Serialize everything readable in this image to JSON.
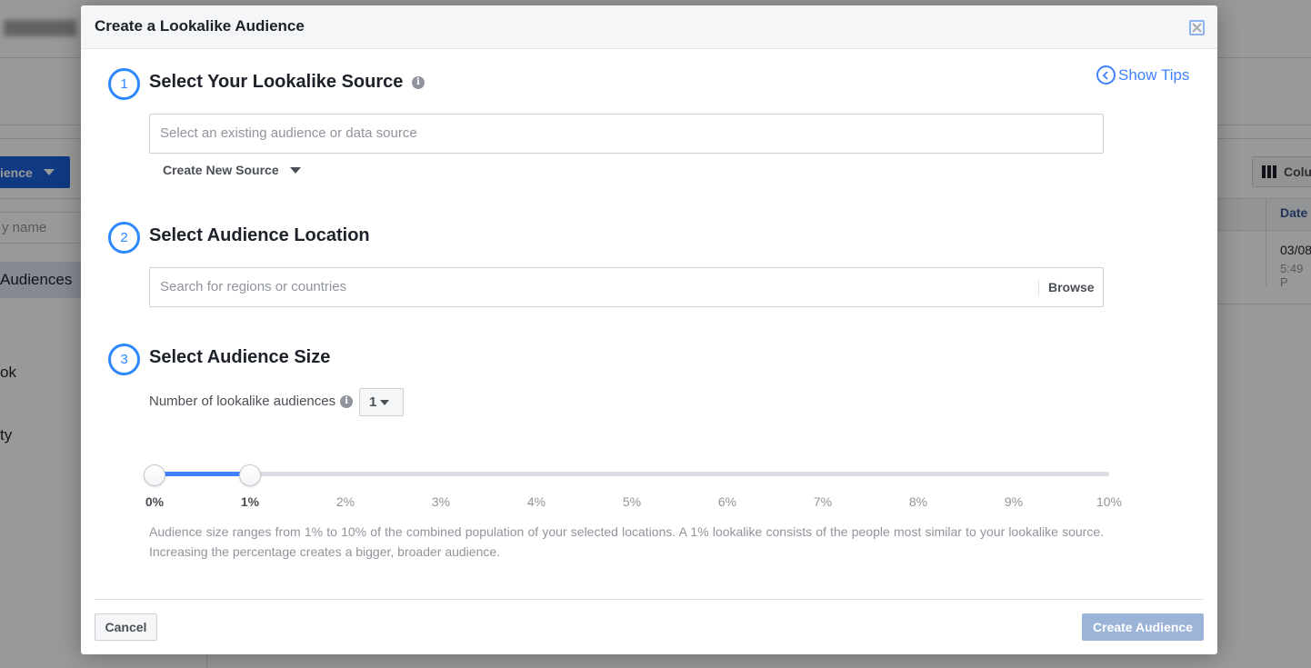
{
  "background": {
    "create_button_label": "ience",
    "search_placeholder": "y name",
    "sidebar_items": [
      {
        "label": "Audiences",
        "active": true
      },
      {
        "label": "ok"
      },
      {
        "label": "ty"
      }
    ],
    "columns_button_label": "Colu",
    "table_header_date": "Date",
    "row_date": "03/08",
    "row_time": "5:49 P"
  },
  "modal": {
    "title": "Create a Lookalike Audience",
    "show_tips_label": "Show Tips",
    "steps": [
      {
        "number": "1",
        "title": "Select Your Lookalike Source"
      },
      {
        "number": "2",
        "title": "Select Audience Location"
      },
      {
        "number": "3",
        "title": "Select Audience Size"
      }
    ],
    "source_input": {
      "placeholder": "Select an existing audience or data source",
      "value": ""
    },
    "create_new_source_label": "Create New Source",
    "location_input": {
      "placeholder": "Search for regions or countries",
      "value": ""
    },
    "browse_label": "Browse",
    "num_audiences_label": "Number of lookalike audiences",
    "num_audiences_value": "1",
    "slider": {
      "min_percent": 0,
      "max_percent": 10,
      "range_start_percent": 0,
      "range_end_percent": 1,
      "ticks": [
        "0%",
        "1%",
        "2%",
        "3%",
        "4%",
        "5%",
        "6%",
        "7%",
        "8%",
        "9%",
        "10%"
      ]
    },
    "description": "Audience size ranges from 1% to 10% of the combined population of your selected locations. A 1% lookalike consists of the people most similar to your lookalike source. Increasing the percentage creates a bigger, broader audience.",
    "cancel_label": "Cancel",
    "create_label": "Create Audience"
  },
  "colors": {
    "accent": "#2d88ff",
    "link": "#4080ff",
    "disabled_button": "#9cb4d8"
  }
}
